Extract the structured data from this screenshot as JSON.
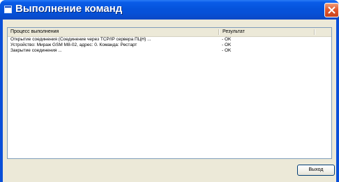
{
  "window": {
    "title": "Выполнение команд"
  },
  "list": {
    "columns": [
      "Процесс выполнения",
      "Результат"
    ],
    "rows": [
      {
        "process": "Открытие соединения (Соединение через TCP/IP сервера ПЦН) ...",
        "result": "- OK"
      },
      {
        "process": "Устройство: Мираж GSM M8-02, адрес: 0. Команда: Рестарт",
        "result": "- OK"
      },
      {
        "process": "Закрытие соединения ...",
        "result": "- OK"
      }
    ]
  },
  "buttons": {
    "exit_label": "Выход"
  },
  "colors": {
    "titlebar": "#0553dc",
    "dialog_face": "#ece9d8",
    "close_button": "#e2582c"
  },
  "icons": {
    "window_icon": "window-icon",
    "close_icon": "close-icon"
  }
}
